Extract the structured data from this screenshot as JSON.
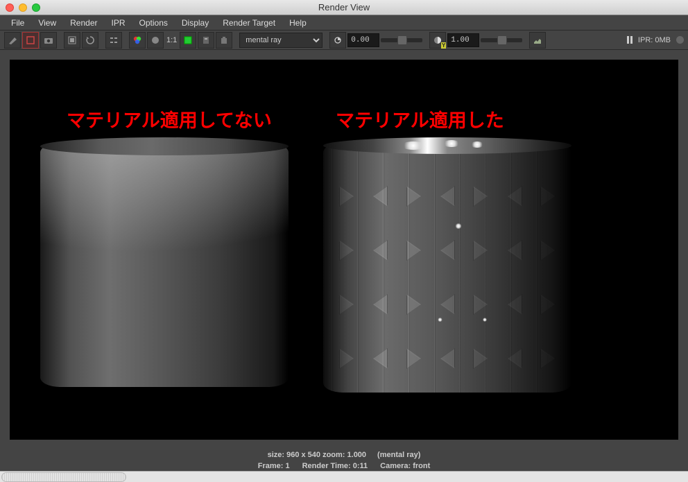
{
  "window": {
    "title": "Render View"
  },
  "menu": {
    "file": "File",
    "view": "View",
    "render": "Render",
    "ipr": "IPR",
    "options": "Options",
    "display": "Display",
    "target": "Render Target",
    "help": "Help"
  },
  "toolbar": {
    "renderer": "mental ray",
    "ratio": "1:1",
    "exposure_value": "0.00",
    "gamma_value": "1.00",
    "gamma_badge": "Y",
    "ipr_status": "IPR: 0MB"
  },
  "annotations": {
    "left": "マテリアル適用してない",
    "right": "マテリアル適用した"
  },
  "status": {
    "size": "size: 960 x 540 zoom: 1.000",
    "renderer": "(mental ray)",
    "frame": "Frame: 1",
    "time": "Render Time: 0:11",
    "camera": "Camera: front"
  }
}
